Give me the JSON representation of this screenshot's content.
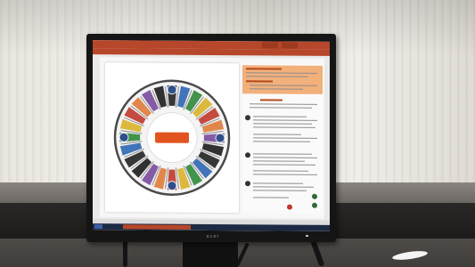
{
  "window": {
    "title": "",
    "controls": [
      "",
      ""
    ]
  },
  "ribbon": {
    "tabs": [
      "",
      "",
      "",
      "",
      "",
      "",
      "",
      "",
      ""
    ]
  },
  "slide": {
    "center_label": "",
    "wheel_segments": 24
  },
  "colors": {
    "app_accent": "#b7472a",
    "wheel_ring": "#4a4a4a",
    "notes_highlight": "#f2b07b",
    "taskbar": "#1d2a44",
    "segment_palette": [
      "#222222",
      "#2f66b3",
      "#2f8a3a",
      "#d9b22a",
      "#c0392b",
      "#e07b39",
      "#7a4a9c",
      "#1c1c1c"
    ]
  },
  "monitor": {
    "brand": "acer"
  },
  "taskbar": {
    "items": [
      "",
      "",
      "",
      ""
    ]
  }
}
